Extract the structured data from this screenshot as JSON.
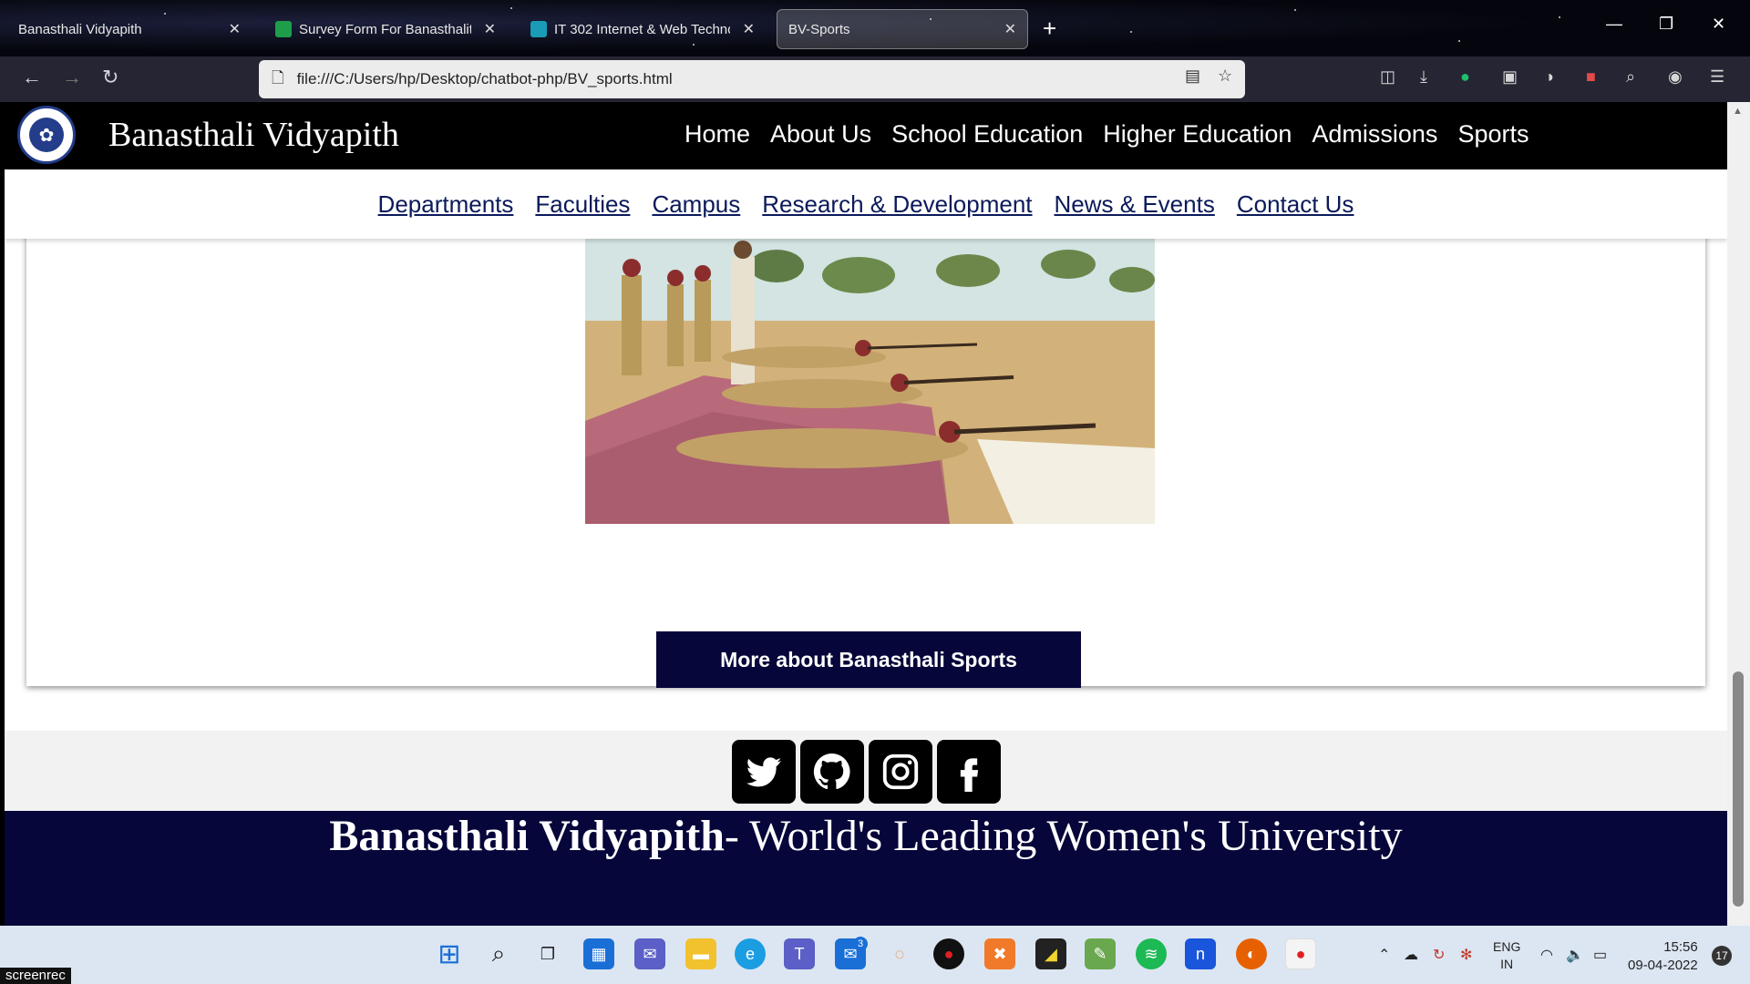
{
  "browser": {
    "tabs": [
      {
        "title": "Banasthali Vidyapith",
        "active": false
      },
      {
        "title": "Survey Form For Banasthalites (",
        "active": false
      },
      {
        "title": "IT 302 Internet & Web Technolo",
        "active": false
      },
      {
        "title": "BV-Sports",
        "active": true
      }
    ],
    "url": "file:///C:/Users/hp/Desktop/chatbot-php/BV_sports.html"
  },
  "site": {
    "name": "Banasthali Vidyapith",
    "main_nav": [
      "Home",
      "About Us",
      "School Education",
      "Higher Education",
      "Admissions",
      "Sports"
    ],
    "sub_nav": [
      "Departments",
      "Faculties",
      "Campus",
      "Research & Development",
      "News & Events",
      "Contact Us"
    ],
    "more_button": "More about Banasthali Sports",
    "social": [
      "twitter",
      "github",
      "instagram",
      "facebook"
    ],
    "footer_bold": "Banasthali Vidyapith",
    "footer_rest": "- World's Leading Women's University"
  },
  "taskbar": {
    "mail_badge": "3",
    "lang": "ENG",
    "region": "IN",
    "time": "15:56",
    "date": "09-04-2022",
    "notif_count": "17"
  },
  "recorder_label": "screenrec",
  "colors": {
    "footer": "#06063a",
    "header": "#000000",
    "subnav_link": "#0b1a5a"
  }
}
